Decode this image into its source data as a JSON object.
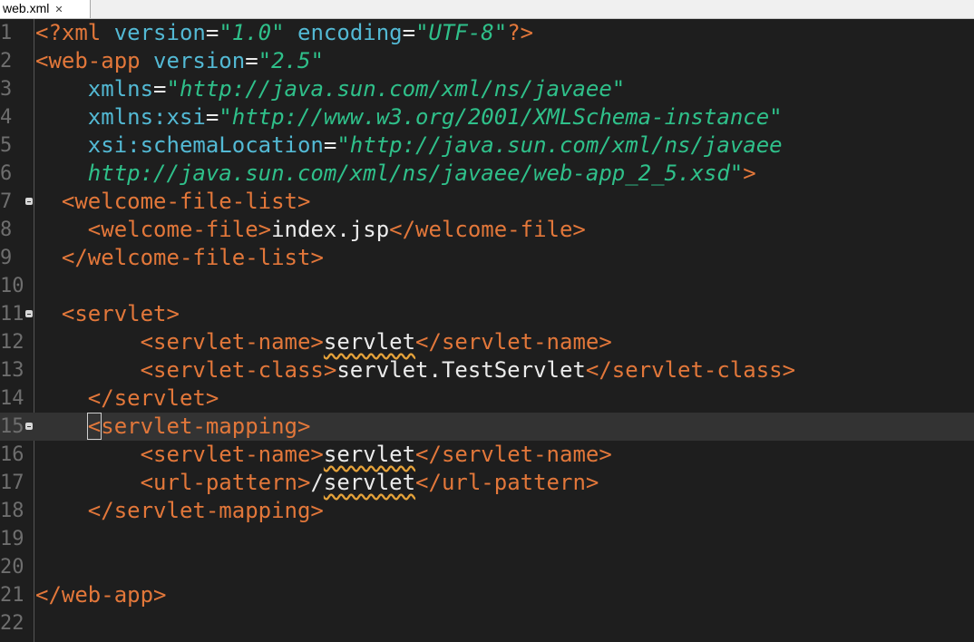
{
  "tab": {
    "title": "web.xml",
    "close_icon": "✕"
  },
  "lines": [
    {
      "n": "1",
      "fold": false,
      "current": false,
      "tokens": [
        {
          "c": "t",
          "v": "<?xml "
        },
        {
          "c": "a",
          "v": "version"
        },
        {
          "c": "x",
          "v": "="
        },
        {
          "c": "s",
          "v": "\"1.0\""
        },
        {
          "c": "x",
          "v": " "
        },
        {
          "c": "a",
          "v": "encoding"
        },
        {
          "c": "x",
          "v": "="
        },
        {
          "c": "s",
          "v": "\"UTF-8\""
        },
        {
          "c": "t",
          "v": "?>"
        }
      ]
    },
    {
      "n": "2",
      "fold": false,
      "current": false,
      "tokens": [
        {
          "c": "t",
          "v": "<web-app "
        },
        {
          "c": "a",
          "v": "version"
        },
        {
          "c": "x",
          "v": "="
        },
        {
          "c": "s",
          "v": "\"2.5\""
        }
      ]
    },
    {
      "n": "3",
      "fold": false,
      "current": false,
      "tokens": [
        {
          "c": "x",
          "v": "    "
        },
        {
          "c": "a",
          "v": "xmlns"
        },
        {
          "c": "x",
          "v": "="
        },
        {
          "c": "s",
          "v": "\"http://java.sun.com/xml/ns/javaee\""
        }
      ]
    },
    {
      "n": "4",
      "fold": false,
      "current": false,
      "tokens": [
        {
          "c": "x",
          "v": "    "
        },
        {
          "c": "a",
          "v": "xmlns:xsi"
        },
        {
          "c": "x",
          "v": "="
        },
        {
          "c": "s",
          "v": "\"http://www.w3.org/2001/XMLSchema-instance\""
        }
      ]
    },
    {
      "n": "5",
      "fold": false,
      "current": false,
      "tokens": [
        {
          "c": "x",
          "v": "    "
        },
        {
          "c": "a",
          "v": "xsi:schemaLocation"
        },
        {
          "c": "x",
          "v": "="
        },
        {
          "c": "s",
          "v": "\"http://java.sun.com/xml/ns/javaee"
        }
      ]
    },
    {
      "n": "6",
      "fold": false,
      "current": false,
      "tokens": [
        {
          "c": "x",
          "v": "    "
        },
        {
          "c": "s",
          "v": "http://java.sun.com/xml/ns/javaee/web-app_2_5.xsd\""
        },
        {
          "c": "t",
          "v": ">"
        }
      ]
    },
    {
      "n": "7",
      "fold": true,
      "current": false,
      "tokens": [
        {
          "c": "x",
          "v": "  "
        },
        {
          "c": "t",
          "v": "<welcome-file-list>"
        }
      ]
    },
    {
      "n": "8",
      "fold": false,
      "current": false,
      "tokens": [
        {
          "c": "x",
          "v": "    "
        },
        {
          "c": "t",
          "v": "<welcome-file>"
        },
        {
          "c": "x",
          "v": "index.jsp"
        },
        {
          "c": "t",
          "v": "</welcome-file>"
        }
      ]
    },
    {
      "n": "9",
      "fold": false,
      "current": false,
      "tokens": [
        {
          "c": "x",
          "v": "  "
        },
        {
          "c": "t",
          "v": "</welcome-file-list>"
        }
      ]
    },
    {
      "n": "10",
      "fold": false,
      "current": false,
      "tokens": []
    },
    {
      "n": "11",
      "fold": true,
      "current": false,
      "tokens": [
        {
          "c": "x",
          "v": "  "
        },
        {
          "c": "t",
          "v": "<servlet>"
        }
      ]
    },
    {
      "n": "12",
      "fold": false,
      "current": false,
      "tokens": [
        {
          "c": "x",
          "v": "        "
        },
        {
          "c": "t",
          "v": "<servlet-name>"
        },
        {
          "c": "x sq",
          "v": "servlet"
        },
        {
          "c": "t",
          "v": "</servlet-name>"
        }
      ]
    },
    {
      "n": "13",
      "fold": false,
      "current": false,
      "tokens": [
        {
          "c": "x",
          "v": "        "
        },
        {
          "c": "t",
          "v": "<servlet-class>"
        },
        {
          "c": "x",
          "v": "servlet.TestServlet"
        },
        {
          "c": "t",
          "v": "</servlet-class>"
        }
      ]
    },
    {
      "n": "14",
      "fold": false,
      "current": false,
      "tokens": [
        {
          "c": "x",
          "v": "    "
        },
        {
          "c": "t",
          "v": "</servlet>"
        }
      ]
    },
    {
      "n": "15",
      "fold": true,
      "current": true,
      "tokens": [
        {
          "c": "x",
          "v": "    "
        },
        {
          "c": "t caret",
          "v": "<"
        },
        {
          "c": "t",
          "v": "servlet-mapping>"
        }
      ]
    },
    {
      "n": "16",
      "fold": false,
      "current": false,
      "tokens": [
        {
          "c": "x",
          "v": "        "
        },
        {
          "c": "t",
          "v": "<servlet-name>"
        },
        {
          "c": "x sq",
          "v": "servlet"
        },
        {
          "c": "t",
          "v": "</servlet-name>"
        }
      ]
    },
    {
      "n": "17",
      "fold": false,
      "current": false,
      "tokens": [
        {
          "c": "x",
          "v": "        "
        },
        {
          "c": "t",
          "v": "<url-pattern>"
        },
        {
          "c": "x",
          "v": "/"
        },
        {
          "c": "x sq",
          "v": "servlet"
        },
        {
          "c": "t",
          "v": "</url-pattern>"
        }
      ]
    },
    {
      "n": "18",
      "fold": false,
      "current": false,
      "tokens": [
        {
          "c": "x",
          "v": "    "
        },
        {
          "c": "t",
          "v": "</servlet-mapping>"
        }
      ]
    },
    {
      "n": "19",
      "fold": false,
      "current": false,
      "tokens": []
    },
    {
      "n": "20",
      "fold": false,
      "current": false,
      "tokens": []
    },
    {
      "n": "21",
      "fold": false,
      "current": false,
      "tokens": [
        {
          "c": "t",
          "v": "</web-app>"
        }
      ]
    },
    {
      "n": "22",
      "fold": false,
      "current": false,
      "tokens": []
    }
  ]
}
